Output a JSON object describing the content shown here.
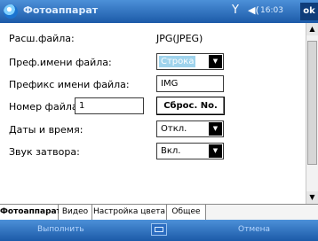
{
  "titlebar": {
    "app_title": "Фотоаппарат",
    "time": "16:03",
    "ok_label": "ok",
    "icons": {
      "signal": "signal-icon",
      "volume": "volume-icon"
    }
  },
  "form": {
    "ext_label": "Расш.файла:",
    "ext_value": "JPG(JPEG)",
    "name_prefix_label": "Преф.имени файла:",
    "name_prefix_value": "Строка",
    "prefix_label": "Префикс имени файла:",
    "prefix_value": "IMG",
    "number_label": "Номер файла:",
    "number_value": "1",
    "reset_button": "Сброс. No.",
    "datetime_label": "Даты и время:",
    "datetime_value": "Откл.",
    "shutter_label": "Звук затвора:",
    "shutter_value": "Вкл."
  },
  "tabs": [
    "Фотоаппарат",
    "Видео",
    "Настройка цвета",
    "Общее"
  ],
  "menubar": {
    "left": "Выполнить",
    "right": "Отмена"
  }
}
